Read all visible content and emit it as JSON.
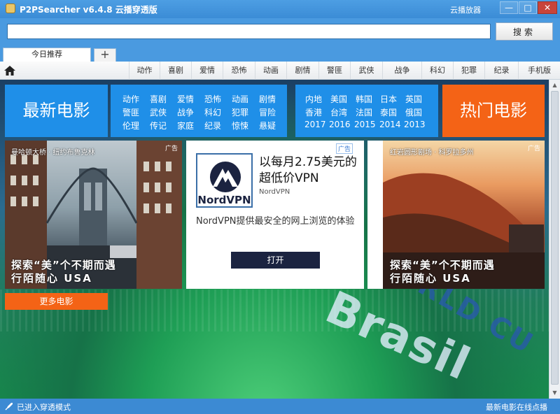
{
  "window": {
    "title": "P2PSearcher v6.4.8 云播穿透版",
    "cloud_player": "云播放器",
    "min": "—",
    "max": "□",
    "close": "✕"
  },
  "search": {
    "value": "",
    "placeholder": "",
    "button": "搜索"
  },
  "tabs": {
    "active": "今日推荐",
    "add": "+"
  },
  "nav": {
    "items": [
      "动作",
      "喜剧",
      "爱情",
      "恐怖",
      "动画",
      "剧情",
      "警匪",
      "武侠",
      "战争",
      "科幻",
      "犯罪",
      "纪录",
      "手机版"
    ]
  },
  "tiles": {
    "latest": "最新电影",
    "hot": "热门电影",
    "more": "更多电影"
  },
  "genres": {
    "rows": [
      [
        "动作",
        "喜剧",
        "爱情",
        "恐怖",
        "动画",
        "剧情"
      ],
      [
        "警匪",
        "武侠",
        "战争",
        "科幻",
        "犯罪",
        "冒险"
      ],
      [
        "伦理",
        "传记",
        "家庭",
        "纪录",
        "惊悚",
        "悬疑"
      ]
    ]
  },
  "regions": {
    "rows": [
      [
        "内地",
        "美国",
        "韩国",
        "日本",
        "英国"
      ],
      [
        "香港",
        "台湾",
        "法国",
        "泰国",
        "俄国"
      ],
      [
        "2017",
        "2016",
        "2015",
        "2014",
        "2013"
      ]
    ]
  },
  "ads": {
    "left": {
      "top_text": "曼哈顿大桥 · 纽约布鲁克林",
      "caption": "探索“美”个不期而遇",
      "sub": "行陌随心 USA",
      "badge": "广告"
    },
    "center": {
      "badge": "广告",
      "logo_text": "NordVPN",
      "headline": "以每月2.75美元的超低价VPN",
      "brand": "NordVPN",
      "description": "NordVPN提供最安全的网上浏览的体验",
      "button": "打开"
    },
    "right": {
      "top_text": "红岩圆形剧场 · 科罗拉多州",
      "caption": "探索“美”个不期而遇",
      "sub": "行陌随心 USA",
      "badge": "广告"
    }
  },
  "background": {
    "brasil": "Brasil",
    "world_cup": "WORLD CU"
  },
  "status": {
    "left": "已进入穿透模式",
    "right": "最新电影在线点播"
  }
}
